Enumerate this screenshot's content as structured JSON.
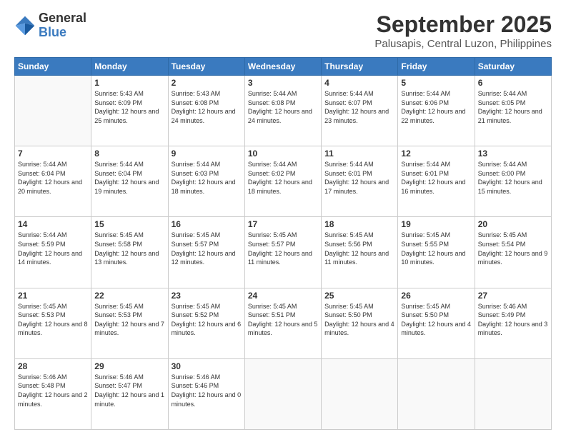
{
  "header": {
    "logo_line1": "General",
    "logo_line2": "Blue",
    "title": "September 2025",
    "subtitle": "Palusapis, Central Luzon, Philippines"
  },
  "calendar": {
    "days_of_week": [
      "Sunday",
      "Monday",
      "Tuesday",
      "Wednesday",
      "Thursday",
      "Friday",
      "Saturday"
    ],
    "weeks": [
      [
        {
          "day": "",
          "sunrise": "",
          "sunset": "",
          "daylight": ""
        },
        {
          "day": "1",
          "sunrise": "Sunrise: 5:43 AM",
          "sunset": "Sunset: 6:09 PM",
          "daylight": "Daylight: 12 hours and 25 minutes."
        },
        {
          "day": "2",
          "sunrise": "Sunrise: 5:43 AM",
          "sunset": "Sunset: 6:08 PM",
          "daylight": "Daylight: 12 hours and 24 minutes."
        },
        {
          "day": "3",
          "sunrise": "Sunrise: 5:44 AM",
          "sunset": "Sunset: 6:08 PM",
          "daylight": "Daylight: 12 hours and 24 minutes."
        },
        {
          "day": "4",
          "sunrise": "Sunrise: 5:44 AM",
          "sunset": "Sunset: 6:07 PM",
          "daylight": "Daylight: 12 hours and 23 minutes."
        },
        {
          "day": "5",
          "sunrise": "Sunrise: 5:44 AM",
          "sunset": "Sunset: 6:06 PM",
          "daylight": "Daylight: 12 hours and 22 minutes."
        },
        {
          "day": "6",
          "sunrise": "Sunrise: 5:44 AM",
          "sunset": "Sunset: 6:05 PM",
          "daylight": "Daylight: 12 hours and 21 minutes."
        }
      ],
      [
        {
          "day": "7",
          "sunrise": "Sunrise: 5:44 AM",
          "sunset": "Sunset: 6:04 PM",
          "daylight": "Daylight: 12 hours and 20 minutes."
        },
        {
          "day": "8",
          "sunrise": "Sunrise: 5:44 AM",
          "sunset": "Sunset: 6:04 PM",
          "daylight": "Daylight: 12 hours and 19 minutes."
        },
        {
          "day": "9",
          "sunrise": "Sunrise: 5:44 AM",
          "sunset": "Sunset: 6:03 PM",
          "daylight": "Daylight: 12 hours and 18 minutes."
        },
        {
          "day": "10",
          "sunrise": "Sunrise: 5:44 AM",
          "sunset": "Sunset: 6:02 PM",
          "daylight": "Daylight: 12 hours and 18 minutes."
        },
        {
          "day": "11",
          "sunrise": "Sunrise: 5:44 AM",
          "sunset": "Sunset: 6:01 PM",
          "daylight": "Daylight: 12 hours and 17 minutes."
        },
        {
          "day": "12",
          "sunrise": "Sunrise: 5:44 AM",
          "sunset": "Sunset: 6:01 PM",
          "daylight": "Daylight: 12 hours and 16 minutes."
        },
        {
          "day": "13",
          "sunrise": "Sunrise: 5:44 AM",
          "sunset": "Sunset: 6:00 PM",
          "daylight": "Daylight: 12 hours and 15 minutes."
        }
      ],
      [
        {
          "day": "14",
          "sunrise": "Sunrise: 5:44 AM",
          "sunset": "Sunset: 5:59 PM",
          "daylight": "Daylight: 12 hours and 14 minutes."
        },
        {
          "day": "15",
          "sunrise": "Sunrise: 5:45 AM",
          "sunset": "Sunset: 5:58 PM",
          "daylight": "Daylight: 12 hours and 13 minutes."
        },
        {
          "day": "16",
          "sunrise": "Sunrise: 5:45 AM",
          "sunset": "Sunset: 5:57 PM",
          "daylight": "Daylight: 12 hours and 12 minutes."
        },
        {
          "day": "17",
          "sunrise": "Sunrise: 5:45 AM",
          "sunset": "Sunset: 5:57 PM",
          "daylight": "Daylight: 12 hours and 11 minutes."
        },
        {
          "day": "18",
          "sunrise": "Sunrise: 5:45 AM",
          "sunset": "Sunset: 5:56 PM",
          "daylight": "Daylight: 12 hours and 11 minutes."
        },
        {
          "day": "19",
          "sunrise": "Sunrise: 5:45 AM",
          "sunset": "Sunset: 5:55 PM",
          "daylight": "Daylight: 12 hours and 10 minutes."
        },
        {
          "day": "20",
          "sunrise": "Sunrise: 5:45 AM",
          "sunset": "Sunset: 5:54 PM",
          "daylight": "Daylight: 12 hours and 9 minutes."
        }
      ],
      [
        {
          "day": "21",
          "sunrise": "Sunrise: 5:45 AM",
          "sunset": "Sunset: 5:53 PM",
          "daylight": "Daylight: 12 hours and 8 minutes."
        },
        {
          "day": "22",
          "sunrise": "Sunrise: 5:45 AM",
          "sunset": "Sunset: 5:53 PM",
          "daylight": "Daylight: 12 hours and 7 minutes."
        },
        {
          "day": "23",
          "sunrise": "Sunrise: 5:45 AM",
          "sunset": "Sunset: 5:52 PM",
          "daylight": "Daylight: 12 hours and 6 minutes."
        },
        {
          "day": "24",
          "sunrise": "Sunrise: 5:45 AM",
          "sunset": "Sunset: 5:51 PM",
          "daylight": "Daylight: 12 hours and 5 minutes."
        },
        {
          "day": "25",
          "sunrise": "Sunrise: 5:45 AM",
          "sunset": "Sunset: 5:50 PM",
          "daylight": "Daylight: 12 hours and 4 minutes."
        },
        {
          "day": "26",
          "sunrise": "Sunrise: 5:45 AM",
          "sunset": "Sunset: 5:50 PM",
          "daylight": "Daylight: 12 hours and 4 minutes."
        },
        {
          "day": "27",
          "sunrise": "Sunrise: 5:46 AM",
          "sunset": "Sunset: 5:49 PM",
          "daylight": "Daylight: 12 hours and 3 minutes."
        }
      ],
      [
        {
          "day": "28",
          "sunrise": "Sunrise: 5:46 AM",
          "sunset": "Sunset: 5:48 PM",
          "daylight": "Daylight: 12 hours and 2 minutes."
        },
        {
          "day": "29",
          "sunrise": "Sunrise: 5:46 AM",
          "sunset": "Sunset: 5:47 PM",
          "daylight": "Daylight: 12 hours and 1 minute."
        },
        {
          "day": "30",
          "sunrise": "Sunrise: 5:46 AM",
          "sunset": "Sunset: 5:46 PM",
          "daylight": "Daylight: 12 hours and 0 minutes."
        },
        {
          "day": "",
          "sunrise": "",
          "sunset": "",
          "daylight": ""
        },
        {
          "day": "",
          "sunrise": "",
          "sunset": "",
          "daylight": ""
        },
        {
          "day": "",
          "sunrise": "",
          "sunset": "",
          "daylight": ""
        },
        {
          "day": "",
          "sunrise": "",
          "sunset": "",
          "daylight": ""
        }
      ]
    ]
  }
}
